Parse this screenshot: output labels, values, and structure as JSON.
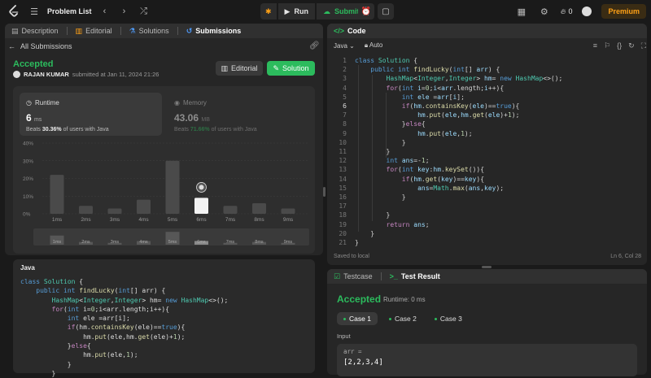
{
  "topbar": {
    "title": "Problem List",
    "run_label": "Run",
    "submit_label": "Submit",
    "streak_count": "0",
    "premium_label": "Premium"
  },
  "left_tabs": [
    "Description",
    "Editorial",
    "Solutions",
    "Submissions"
  ],
  "submission": {
    "back_label": "All Submissions",
    "status": "Accepted",
    "user": "RAJAN KUMAR",
    "submitted_text": "submitted at Jan 11, 2024 21:26",
    "editorial_button": "Editorial",
    "solution_button": "Solution"
  },
  "runtime": {
    "label": "Runtime",
    "value": "6",
    "unit": "ms",
    "beats_prefix": "Beats",
    "beats_pct": "30.36%",
    "beats_suffix": "of users with Java"
  },
  "memory": {
    "label": "Memory",
    "value": "43.06",
    "unit": "MB",
    "beats_prefix": "Beats",
    "beats_pct": "71.66%",
    "beats_suffix": "of users with Java"
  },
  "chart_data": {
    "type": "bar",
    "categories": [
      "1ms",
      "2ms",
      "3ms",
      "4ms",
      "5ms",
      "6ms",
      "7ms",
      "8ms",
      "9ms"
    ],
    "values": [
      22,
      4.5,
      3,
      8,
      30,
      9,
      4.5,
      6,
      3
    ],
    "highlight_index": 5,
    "yticks": [
      "40%",
      "30%",
      "20%",
      "10%",
      "0%"
    ],
    "ylim": [
      0,
      40
    ],
    "mini_values": [
      5,
      1.5,
      1,
      2,
      7,
      2,
      1,
      1.5,
      1
    ]
  },
  "code_lang": "Java",
  "editor": {
    "tab_label": "Code",
    "lang": "Java",
    "mode": "Auto",
    "saved_text": "Saved to local",
    "cursor_pos": "Ln 6, Col 28",
    "line_numbers": [
      "1",
      "2",
      "3",
      "4",
      "5",
      "6",
      "7",
      "8",
      "9",
      "10",
      "11",
      "12",
      "13",
      "14",
      "15",
      "16",
      "17",
      "18",
      "19",
      "20",
      "21"
    ]
  },
  "result": {
    "tab_testcase": "Testcase",
    "tab_result": "Test Result",
    "status": "Accepted",
    "runtime": "Runtime: 0 ms",
    "cases": [
      "Case 1",
      "Case 2",
      "Case 3"
    ],
    "input_label": "Input",
    "var_name": "arr =",
    "var_value": "[2,2,3,4]"
  }
}
